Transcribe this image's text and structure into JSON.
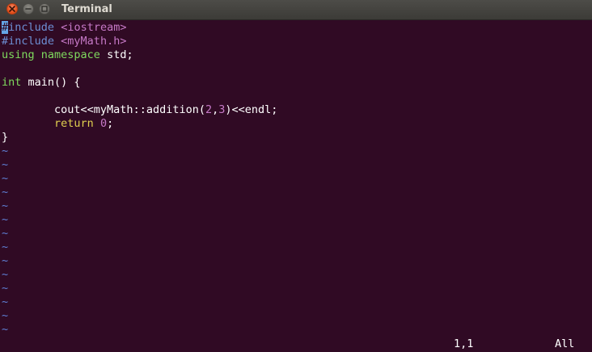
{
  "window": {
    "title": "Terminal"
  },
  "code": {
    "line1": {
      "cursor": "#",
      "directive": "include",
      "header": "<iostream>"
    },
    "line2": {
      "directive": "#include",
      "header": "<myMath.h>"
    },
    "line3": {
      "kw1": "using",
      "kw2": "namespace",
      "rest": "std;"
    },
    "line4": {
      "text": ""
    },
    "line5": {
      "type": "int",
      "rest": "main() {"
    },
    "line6": {
      "text": ""
    },
    "line7": {
      "indent": "        ",
      "pre": "cout<<myMath::addition(",
      "arg1": "2",
      "comma": ",",
      "arg2": "3",
      "post": ")<<endl;"
    },
    "line8": {
      "indent": "        ",
      "stmt": "return",
      "space": " ",
      "num": "0",
      "end": ";"
    },
    "line9": {
      "text": "}"
    }
  },
  "empty_marker": "~",
  "status": {
    "position": "1,1",
    "scroll": "All"
  },
  "colors": {
    "background": "#300a24",
    "preprocessor": "#6d8fd4",
    "string": "#c679c7",
    "keyword": "#7fdb5e",
    "statement": "#e0cf4f",
    "cursor": "#65a5e6"
  }
}
